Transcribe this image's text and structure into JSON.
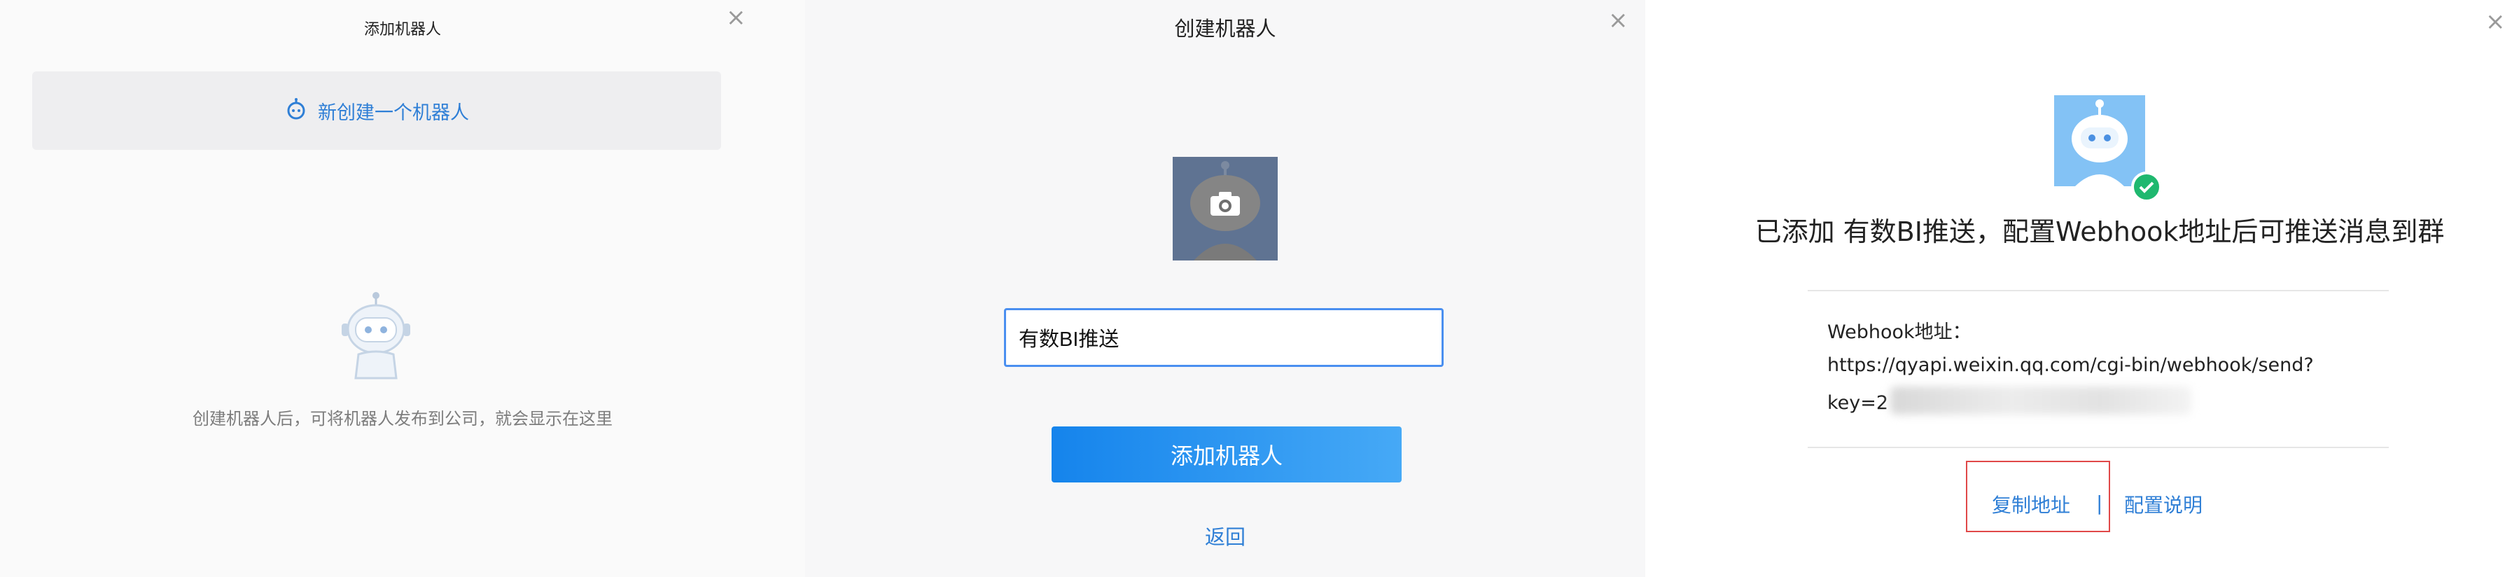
{
  "add_panel": {
    "title": "添加机器人",
    "close_icon": "close-icon",
    "new_bot_label": "新创建一个机器人",
    "new_bot_icon": "robot-icon",
    "empty_text": "创建机器人后，可将机器人发布到公司，就会显示在这里"
  },
  "create_panel": {
    "title": "创建机器人",
    "close_icon": "close-icon",
    "avatar_icon": "camera-icon",
    "name_value": "有数BI推送",
    "add_button": "添加机器人",
    "back_link": "返回"
  },
  "success_panel": {
    "close_icon": "close-icon",
    "headline": "已添加 有数BI推送，配置Webhook地址后可推送消息到群",
    "webhook_label": "Webhook地址：",
    "webhook_url": "https://qyapi.weixin.qq.com/cgi-bin/webhook/send?",
    "webhook_key_prefix": "key=2",
    "copy_link": "复制地址",
    "separator": "|",
    "config_link": "配置说明"
  },
  "colors": {
    "accent": "#2f7fd6",
    "button_start": "#1584ec",
    "button_end": "#46a9f6",
    "success": "#1fb86f",
    "highlight_box": "#e04848"
  }
}
